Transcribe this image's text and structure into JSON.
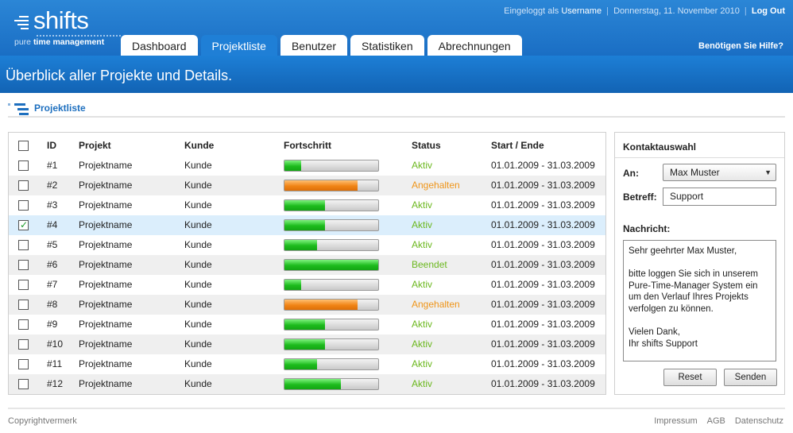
{
  "brand": {
    "name": "shifts",
    "tagline_prefix": "pure",
    "tagline_bold": "time management"
  },
  "topbar": {
    "logged_in_prefix": "Eingeloggt als",
    "username": "Username",
    "date": "Donnerstag, 11. November 2010",
    "logout": "Log Out"
  },
  "tabs": [
    {
      "label": "Dashboard",
      "active": false
    },
    {
      "label": "Projektliste",
      "active": true
    },
    {
      "label": "Benutzer",
      "active": false
    },
    {
      "label": "Statistiken",
      "active": false
    },
    {
      "label": "Abrechnungen",
      "active": false
    }
  ],
  "help": "Benötigen Sie Hilfe?",
  "banner_title": "Überblick aller Projekte und Details.",
  "section_title": "Projektliste",
  "table": {
    "headers": {
      "id": "ID",
      "project": "Projekt",
      "customer": "Kunde",
      "progress": "Fortschritt",
      "status": "Status",
      "dates": "Start / Ende"
    },
    "header_checked": false,
    "rows": [
      {
        "checked": false,
        "id": "#1",
        "project": "Projektname",
        "customer": "Kunde",
        "progress": 0.18,
        "status": "Aktiv",
        "dates": "01.01.2009 - 31.03.2009"
      },
      {
        "checked": false,
        "id": "#2",
        "project": "Projektname",
        "customer": "Kunde",
        "progress": 0.78,
        "status": "Angehalten",
        "dates": "01.01.2009 - 31.03.2009"
      },
      {
        "checked": false,
        "id": "#3",
        "project": "Projektname",
        "customer": "Kunde",
        "progress": 0.43,
        "status": "Aktiv",
        "dates": "01.01.2009 - 31.03.2009"
      },
      {
        "checked": true,
        "id": "#4",
        "project": "Projektname",
        "customer": "Kunde",
        "progress": 0.43,
        "status": "Aktiv",
        "dates": "01.01.2009 - 31.03.2009"
      },
      {
        "checked": false,
        "id": "#5",
        "project": "Projektname",
        "customer": "Kunde",
        "progress": 0.35,
        "status": "Aktiv",
        "dates": "01.01.2009 - 31.03.2009"
      },
      {
        "checked": false,
        "id": "#6",
        "project": "Projektname",
        "customer": "Kunde",
        "progress": 1.0,
        "status": "Beendet",
        "dates": "01.01.2009 - 31.03.2009"
      },
      {
        "checked": false,
        "id": "#7",
        "project": "Projektname",
        "customer": "Kunde",
        "progress": 0.18,
        "status": "Aktiv",
        "dates": "01.01.2009 - 31.03.2009"
      },
      {
        "checked": false,
        "id": "#8",
        "project": "Projektname",
        "customer": "Kunde",
        "progress": 0.78,
        "status": "Angehalten",
        "dates": "01.01.2009 - 31.03.2009"
      },
      {
        "checked": false,
        "id": "#9",
        "project": "Projektname",
        "customer": "Kunde",
        "progress": 0.43,
        "status": "Aktiv",
        "dates": "01.01.2009 - 31.03.2009"
      },
      {
        "checked": false,
        "id": "#10",
        "project": "Projektname",
        "customer": "Kunde",
        "progress": 0.43,
        "status": "Aktiv",
        "dates": "01.01.2009 - 31.03.2009"
      },
      {
        "checked": false,
        "id": "#11",
        "project": "Projektname",
        "customer": "Kunde",
        "progress": 0.35,
        "status": "Aktiv",
        "dates": "01.01.2009 - 31.03.2009"
      },
      {
        "checked": false,
        "id": "#12",
        "project": "Projektname",
        "customer": "Kunde",
        "progress": 0.6,
        "status": "Aktiv",
        "dates": "01.01.2009 - 31.03.2009"
      }
    ]
  },
  "contact": {
    "title": "Kontaktauswahl",
    "to_label": "An:",
    "to_value": "Max Muster",
    "subject_label": "Betreff:",
    "subject_value": "Support",
    "message_label": "Nachricht:",
    "message": "Sehr geehrter Max Muster,\n\nbitte loggen Sie sich in unserem Pure-Time-Manager System ein um den Verlauf Ihres Projekts verfolgen zu können.\n\nVielen Dank,\nIhr shifts Support",
    "reset": "Reset",
    "send": "Senden"
  },
  "footer": {
    "copyright": "Copyrightvermerk",
    "links": [
      "Impressum",
      "AGB",
      "Datenschutz"
    ]
  },
  "colors": {
    "header_blue": "#1a6ec4",
    "status_active": "#6cb81f",
    "status_paused": "#ef9519",
    "progress_green": "#1dbb1d",
    "progress_orange": "#f08416",
    "selected_row": "#dbeefc"
  }
}
